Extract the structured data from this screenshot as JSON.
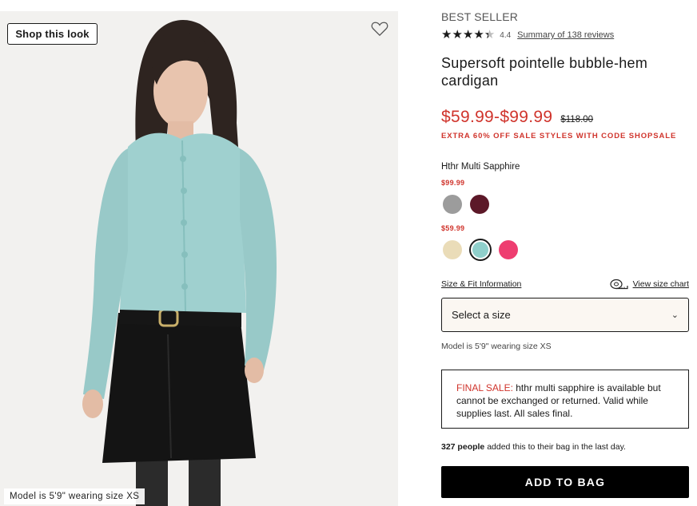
{
  "image": {
    "shop_look_label": "Shop this look",
    "model_caption": "Model is 5'9\" wearing size XS"
  },
  "product": {
    "badge": "BEST SELLER",
    "rating_value": "4.4",
    "rating_stars": 4.4,
    "reviews_link": "Summary of 138 reviews",
    "title": "Supersoft pointelle bubble-hem cardigan",
    "price": "$59.99-$99.99",
    "original_price": "$118.00",
    "promo": "EXTRA 60% OFF SALE STYLES WITH CODE SHOPSALE",
    "color_name": "Hthr Multi Sapphire",
    "swatch_groups": [
      {
        "price": "$99.99",
        "swatches": [
          {
            "name": "heather-grey",
            "color": "#9c9c9c",
            "selected": false
          },
          {
            "name": "burgundy",
            "color": "#5c1828",
            "selected": false
          }
        ]
      },
      {
        "price": "$59.99",
        "swatches": [
          {
            "name": "cream",
            "color": "#eadcb8",
            "selected": false
          },
          {
            "name": "hthr-multi-sapphire",
            "color": "#8fcfcb",
            "selected": true
          },
          {
            "name": "pink",
            "color": "#ee3d70",
            "selected": false
          }
        ]
      }
    ],
    "size_fit_link": "Size & Fit Information",
    "size_chart_link": "View size chart",
    "size_select_placeholder": "Select a size",
    "model_note": "Model is 5'9\" wearing size XS",
    "final_sale_label": "FINAL SALE:",
    "final_sale_text": " hthr multi sapphire is available but cannot be exchanged or returned. Valid while supplies last. All sales final.",
    "social_count": "327 people",
    "social_text": " added this to their bag in the last day.",
    "add_to_bag": "ADD TO BAG"
  },
  "colors": {
    "sale_red": "#d0342c",
    "cardigan": "#9fd0cf",
    "button_bg": "#000000"
  }
}
